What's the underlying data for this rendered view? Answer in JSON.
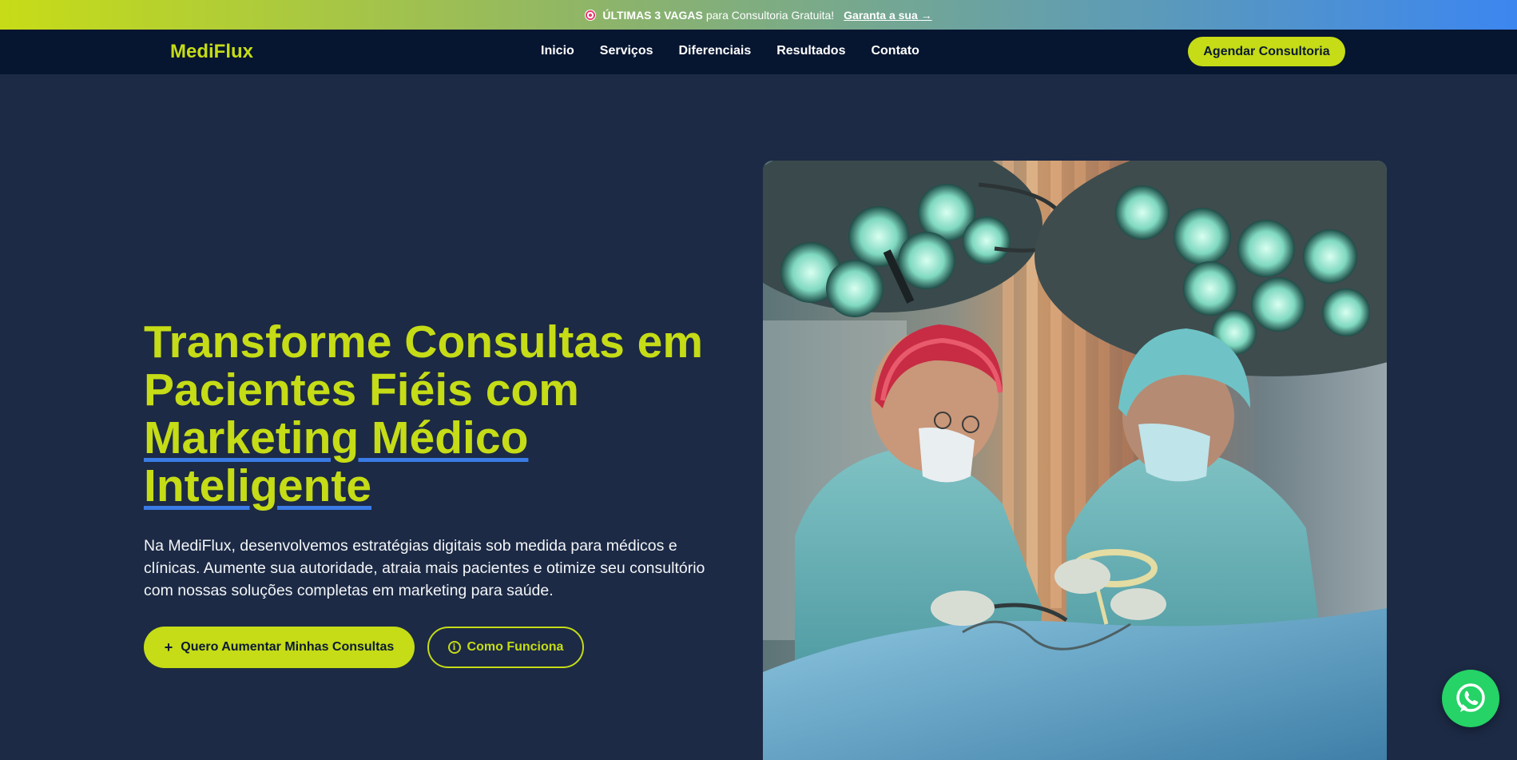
{
  "promo_bar": {
    "icon": "target-icon",
    "strong": "ÚLTIMAS 3 VAGAS",
    "text": "para Consultoria Gratuita!",
    "link": "Garanta a sua →"
  },
  "navbar": {
    "brand": "MediFlux",
    "links": [
      "Inicio",
      "Serviços",
      "Diferenciais",
      "Resultados",
      "Contato"
    ],
    "cta": "Agendar Consultoria"
  },
  "hero": {
    "title_plain": "Transforme Consultas em Pacientes Fiéis com",
    "title_highlight": "Marketing Médico Inteligente",
    "description": "Na MediFlux, desenvolvemos estratégias digitais sob medida para médicos e clínicas. Aumente sua autoridade, atraia mais pacientes e otimize seu consultório com nossas soluções completas em marketing para saúde.",
    "primary_button": "Quero Aumentar Minhas Consultas",
    "primary_icon": "plus-icon",
    "secondary_button": "Como Funciona",
    "secondary_icon": "info-icon",
    "image_subject": "surgeons-operating-room-photo"
  },
  "floating": {
    "icon": "whatsapp-icon"
  },
  "colors": {
    "accent": "#c5dc16",
    "background": "#1c2a45",
    "navbar": "#061530",
    "underline": "#3a7be6",
    "whatsapp": "#25d366"
  }
}
